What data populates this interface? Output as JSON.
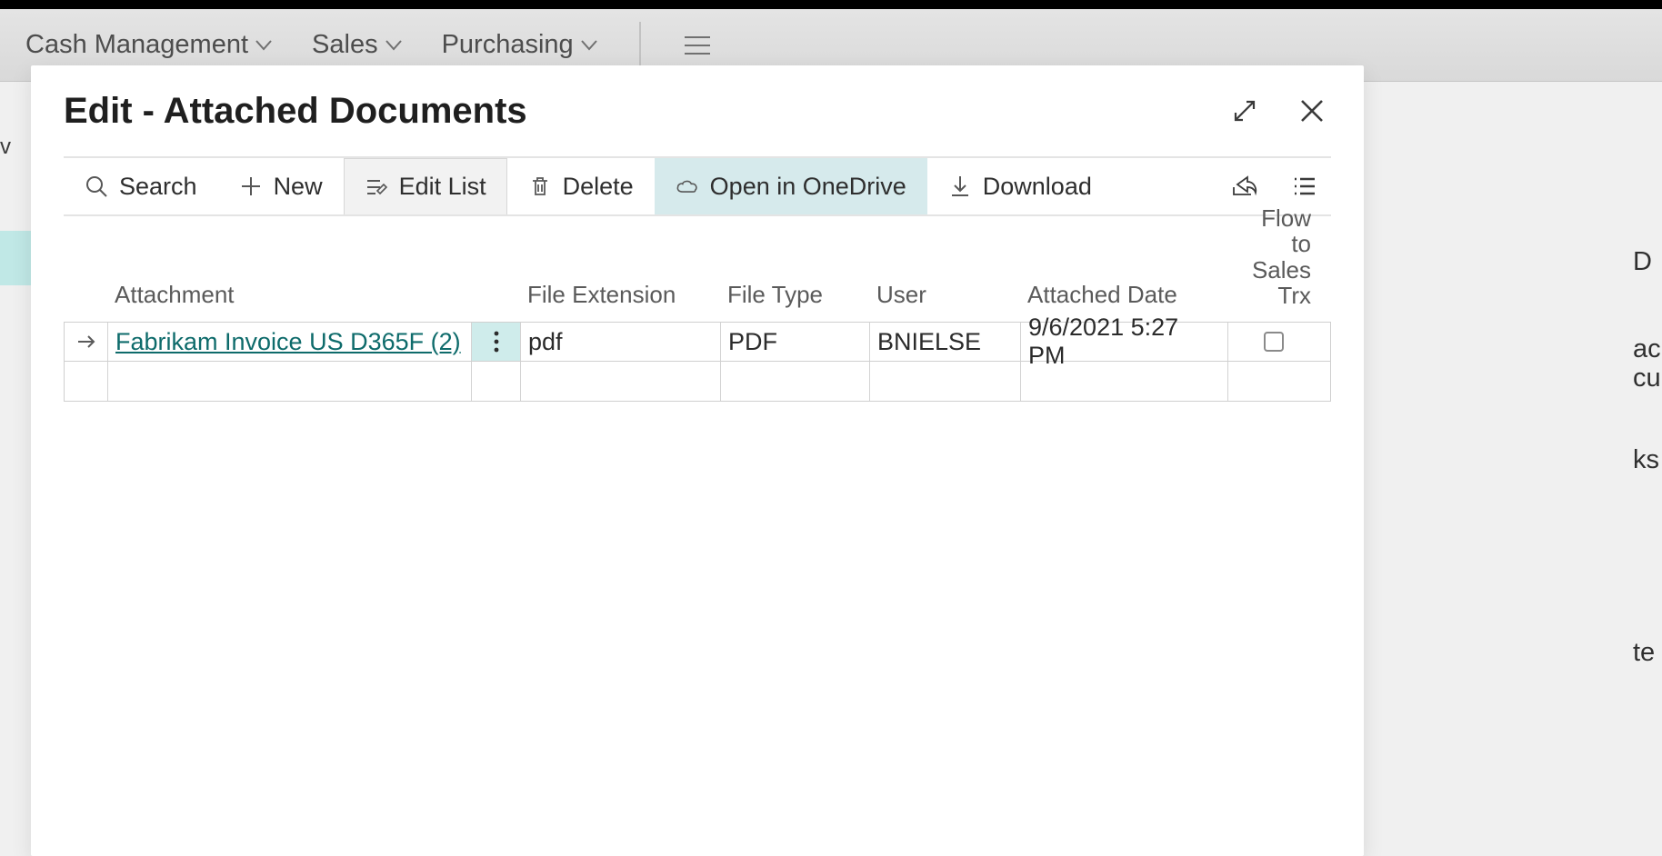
{
  "nav": {
    "items": [
      {
        "label": "Cash Management"
      },
      {
        "label": "Sales"
      },
      {
        "label": "Purchasing"
      }
    ]
  },
  "background": {
    "left_fragment": "v",
    "right_fragments": [
      "D",
      "ac",
      "cur",
      "ks",
      "te"
    ]
  },
  "dialog": {
    "title": "Edit - Attached Documents"
  },
  "toolbar": {
    "search_label": "Search",
    "new_label": "New",
    "editlist_label": "Edit List",
    "delete_label": "Delete",
    "onedrive_label": "Open in OneDrive",
    "download_label": "Download"
  },
  "table": {
    "headers": {
      "attachment": "Attachment",
      "file_extension": "File Extension",
      "file_type": "File Type",
      "user": "User",
      "attached_date": "Attached Date",
      "flow_line1": "Flow",
      "flow_line2": "to",
      "flow_line3": "Sales",
      "flow_line4": "Trx"
    },
    "rows": [
      {
        "attachment": "Fabrikam Invoice US D365F (2)",
        "file_extension": "pdf",
        "file_type": "PDF",
        "user": "BNIELSE",
        "attached_date": "9/6/2021 5:27 PM",
        "flow_checked": false
      }
    ]
  }
}
